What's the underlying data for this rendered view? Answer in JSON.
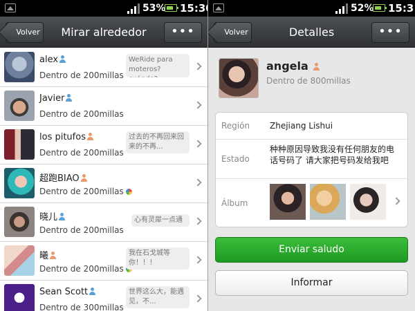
{
  "left_screen": {
    "status": {
      "battery": "53%",
      "time": "15:30"
    },
    "header": {
      "back_label": "Volver",
      "title": "Mirar alrededor",
      "more_label": "•••"
    },
    "rows": [
      {
        "name": "alex",
        "gender": "male",
        "distance": "Dentro de 200millas",
        "status": "WeRide para moteros?cuándo?...",
        "moments": false
      },
      {
        "name": "Javier",
        "gender": "male",
        "distance": "Dentro de 200millas",
        "status": "",
        "moments": false
      },
      {
        "name": "los pitufos",
        "gender": "female",
        "distance": "Dentro de 200millas",
        "status": "过去的不再回来回来的不再...",
        "moments": false
      },
      {
        "name": "超跑BIAO",
        "gender": "female",
        "distance": "Dentro de 200millas",
        "status": "",
        "moments": true
      },
      {
        "name": "晓儿",
        "gender": "male",
        "distance": "Dentro de 200millas",
        "status": "心有灵犀一点通",
        "moments": false
      },
      {
        "name": "曦",
        "gender": "female",
        "distance": "Dentro de 200millas",
        "status": "我在石戈城等你！！！",
        "moments": true
      },
      {
        "name": "Sean Scott",
        "gender": "male",
        "distance": "Dentro de 300millas",
        "status": "世界这么大，能遇见，不...",
        "moments": false
      }
    ]
  },
  "right_screen": {
    "status": {
      "battery": "52%",
      "time": "15:31"
    },
    "header": {
      "back_label": "Volver",
      "title": "Detalles",
      "more_label": "•••"
    },
    "profile": {
      "name": "angela",
      "gender": "female",
      "distance": "Dentro de 800millas"
    },
    "details": {
      "region_label": "Región",
      "region_value": "Zhejiang  Lishui",
      "estado_label": "Estado",
      "estado_value": "种种原因导致我没有任何朋友的电话号码了 请大家把号码发给我吧",
      "album_label": "Álbum"
    },
    "send_button": "Enviar saludo",
    "report_button": "Informar"
  },
  "colors": {
    "accent_green": "#2aa62e",
    "male_icon": "#5aa1d8",
    "female_icon": "#e89a6c"
  }
}
